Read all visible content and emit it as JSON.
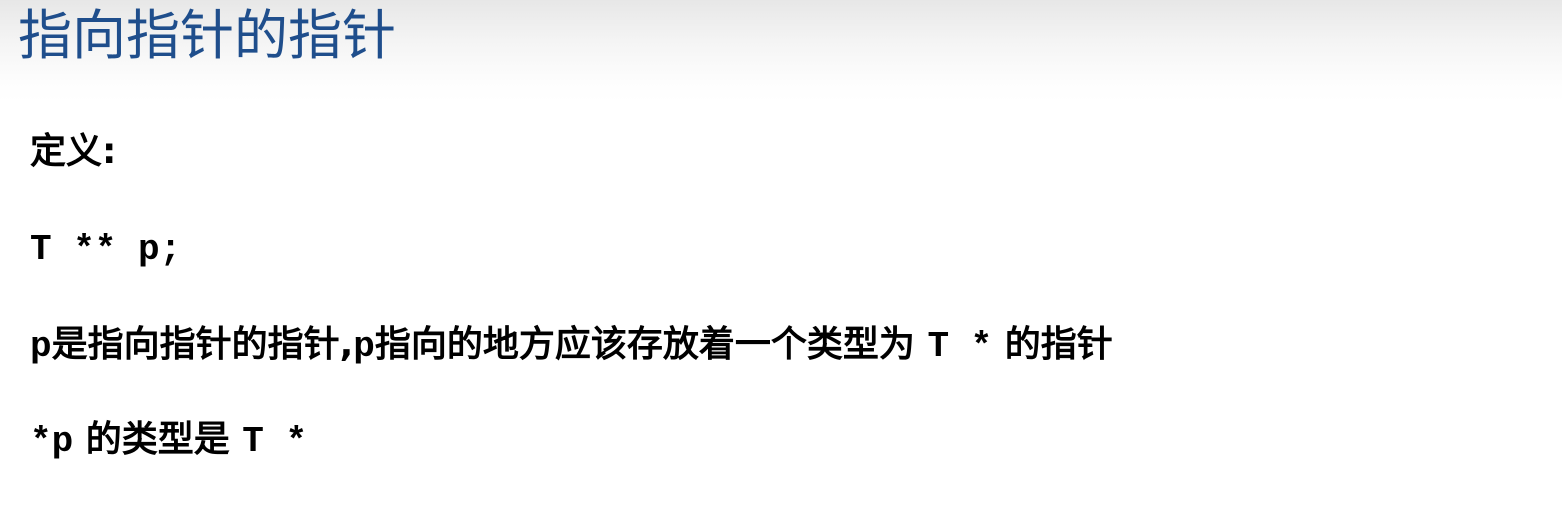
{
  "slide": {
    "title": "指向指针的指针"
  },
  "content": {
    "definition_label": "定义:",
    "code_declaration": "T ** p;",
    "line3": {
      "var_p": "p",
      "text_a": "是指向指针的指针,",
      "var_p2": "p",
      "text_b": "指向的地方应该存放着一个类型为 ",
      "type_code": "T *",
      "text_c": " 的指针"
    },
    "line4": {
      "deref_code": "*p",
      "text": " 的类型是 ",
      "type_code": "T *"
    }
  }
}
